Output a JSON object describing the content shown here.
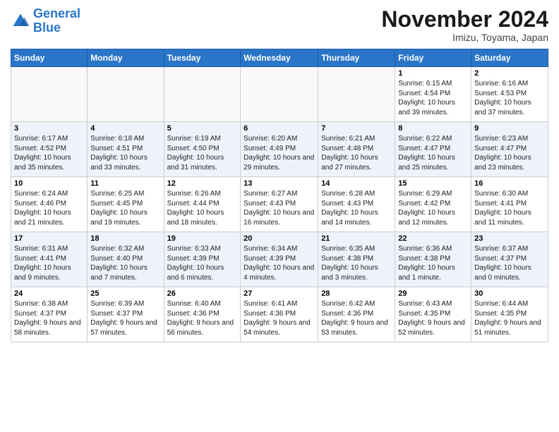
{
  "header": {
    "logo_line1": "General",
    "logo_line2": "Blue",
    "month_title": "November 2024",
    "location": "Imizu, Toyama, Japan"
  },
  "days_of_week": [
    "Sunday",
    "Monday",
    "Tuesday",
    "Wednesday",
    "Thursday",
    "Friday",
    "Saturday"
  ],
  "weeks": [
    [
      {
        "day": "",
        "info": ""
      },
      {
        "day": "",
        "info": ""
      },
      {
        "day": "",
        "info": ""
      },
      {
        "day": "",
        "info": ""
      },
      {
        "day": "",
        "info": ""
      },
      {
        "day": "1",
        "info": "Sunrise: 6:15 AM\nSunset: 4:54 PM\nDaylight: 10 hours and 39 minutes."
      },
      {
        "day": "2",
        "info": "Sunrise: 6:16 AM\nSunset: 4:53 PM\nDaylight: 10 hours and 37 minutes."
      }
    ],
    [
      {
        "day": "3",
        "info": "Sunrise: 6:17 AM\nSunset: 4:52 PM\nDaylight: 10 hours and 35 minutes."
      },
      {
        "day": "4",
        "info": "Sunrise: 6:18 AM\nSunset: 4:51 PM\nDaylight: 10 hours and 33 minutes."
      },
      {
        "day": "5",
        "info": "Sunrise: 6:19 AM\nSunset: 4:50 PM\nDaylight: 10 hours and 31 minutes."
      },
      {
        "day": "6",
        "info": "Sunrise: 6:20 AM\nSunset: 4:49 PM\nDaylight: 10 hours and 29 minutes."
      },
      {
        "day": "7",
        "info": "Sunrise: 6:21 AM\nSunset: 4:48 PM\nDaylight: 10 hours and 27 minutes."
      },
      {
        "day": "8",
        "info": "Sunrise: 6:22 AM\nSunset: 4:47 PM\nDaylight: 10 hours and 25 minutes."
      },
      {
        "day": "9",
        "info": "Sunrise: 6:23 AM\nSunset: 4:47 PM\nDaylight: 10 hours and 23 minutes."
      }
    ],
    [
      {
        "day": "10",
        "info": "Sunrise: 6:24 AM\nSunset: 4:46 PM\nDaylight: 10 hours and 21 minutes."
      },
      {
        "day": "11",
        "info": "Sunrise: 6:25 AM\nSunset: 4:45 PM\nDaylight: 10 hours and 19 minutes."
      },
      {
        "day": "12",
        "info": "Sunrise: 6:26 AM\nSunset: 4:44 PM\nDaylight: 10 hours and 18 minutes."
      },
      {
        "day": "13",
        "info": "Sunrise: 6:27 AM\nSunset: 4:43 PM\nDaylight: 10 hours and 16 minutes."
      },
      {
        "day": "14",
        "info": "Sunrise: 6:28 AM\nSunset: 4:43 PM\nDaylight: 10 hours and 14 minutes."
      },
      {
        "day": "15",
        "info": "Sunrise: 6:29 AM\nSunset: 4:42 PM\nDaylight: 10 hours and 12 minutes."
      },
      {
        "day": "16",
        "info": "Sunrise: 6:30 AM\nSunset: 4:41 PM\nDaylight: 10 hours and 11 minutes."
      }
    ],
    [
      {
        "day": "17",
        "info": "Sunrise: 6:31 AM\nSunset: 4:41 PM\nDaylight: 10 hours and 9 minutes."
      },
      {
        "day": "18",
        "info": "Sunrise: 6:32 AM\nSunset: 4:40 PM\nDaylight: 10 hours and 7 minutes."
      },
      {
        "day": "19",
        "info": "Sunrise: 6:33 AM\nSunset: 4:39 PM\nDaylight: 10 hours and 6 minutes."
      },
      {
        "day": "20",
        "info": "Sunrise: 6:34 AM\nSunset: 4:39 PM\nDaylight: 10 hours and 4 minutes."
      },
      {
        "day": "21",
        "info": "Sunrise: 6:35 AM\nSunset: 4:38 PM\nDaylight: 10 hours and 3 minutes."
      },
      {
        "day": "22",
        "info": "Sunrise: 6:36 AM\nSunset: 4:38 PM\nDaylight: 10 hours and 1 minute."
      },
      {
        "day": "23",
        "info": "Sunrise: 6:37 AM\nSunset: 4:37 PM\nDaylight: 10 hours and 0 minutes."
      }
    ],
    [
      {
        "day": "24",
        "info": "Sunrise: 6:38 AM\nSunset: 4:37 PM\nDaylight: 9 hours and 58 minutes."
      },
      {
        "day": "25",
        "info": "Sunrise: 6:39 AM\nSunset: 4:37 PM\nDaylight: 9 hours and 57 minutes."
      },
      {
        "day": "26",
        "info": "Sunrise: 6:40 AM\nSunset: 4:36 PM\nDaylight: 9 hours and 56 minutes."
      },
      {
        "day": "27",
        "info": "Sunrise: 6:41 AM\nSunset: 4:36 PM\nDaylight: 9 hours and 54 minutes."
      },
      {
        "day": "28",
        "info": "Sunrise: 6:42 AM\nSunset: 4:36 PM\nDaylight: 9 hours and 53 minutes."
      },
      {
        "day": "29",
        "info": "Sunrise: 6:43 AM\nSunset: 4:35 PM\nDaylight: 9 hours and 52 minutes."
      },
      {
        "day": "30",
        "info": "Sunrise: 6:44 AM\nSunset: 4:35 PM\nDaylight: 9 hours and 51 minutes."
      }
    ]
  ]
}
